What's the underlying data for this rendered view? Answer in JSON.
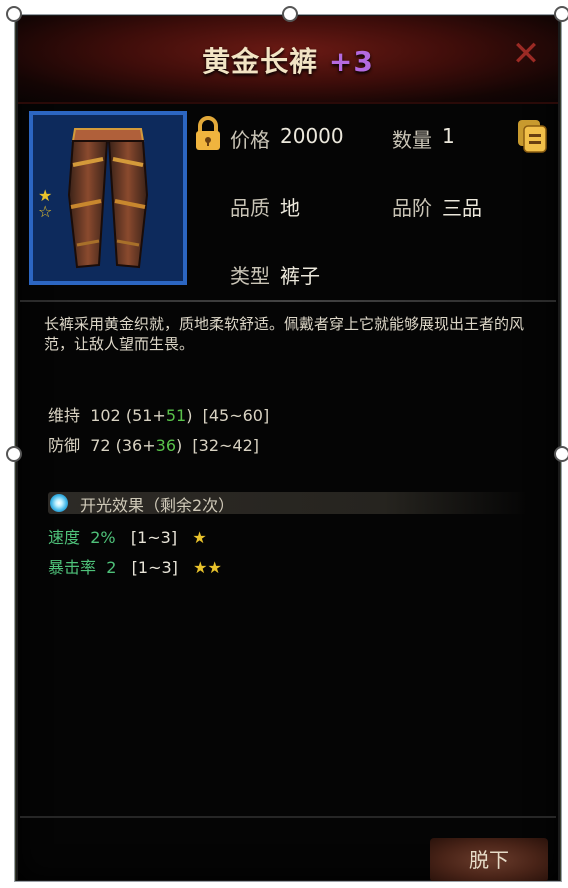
{
  "item": {
    "name": "黄金长裤",
    "enhance": "+3",
    "stars_filled": "★",
    "stars_empty": "☆"
  },
  "info": {
    "price_label": "价格",
    "price_value": "20000",
    "quantity_label": "数量",
    "quantity_value": "1",
    "quality_label": "品质",
    "quality_value": "地",
    "grade_label": "品阶",
    "grade_value": "三品",
    "type_label": "类型",
    "type_value": "裤子"
  },
  "description": "长裤采用黄金织就，质地柔软舒适。佩戴者穿上它就能够展现出王者的风范，让敌人望而生畏。",
  "stats": [
    {
      "name": "维持",
      "total": "102",
      "base": "51",
      "bonus": "51",
      "range": "[45~60]"
    },
    {
      "name": "防御",
      "total": "72",
      "base": "36",
      "bonus": "36",
      "range": "[32~42]"
    }
  ],
  "effects": {
    "title": "开光效果（剩余2次）",
    "items": [
      {
        "name": "速度",
        "value": "2%",
        "range": "[1~3]",
        "stars": "★"
      },
      {
        "name": "暴击率",
        "value": "2",
        "range": "[1~3]",
        "stars": "★★"
      }
    ]
  },
  "buttons": {
    "close": "✕",
    "unequip": "脱下"
  },
  "colors": {
    "enhance": "#b46ae0",
    "bonus_green": "#59c24a",
    "star_gold": "#e9c32c",
    "frame_blue": "#2c66c2"
  }
}
